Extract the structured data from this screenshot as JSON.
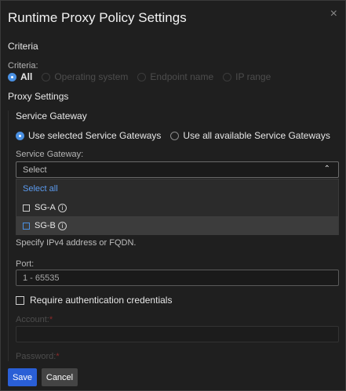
{
  "dialog": {
    "title": "Runtime Proxy Policy Settings",
    "close_icon": "×"
  },
  "criteria": {
    "section_title": "Criteria",
    "label": "Criteria:",
    "options": [
      {
        "label": "All",
        "selected": true,
        "disabled": false
      },
      {
        "label": "Operating system",
        "selected": false,
        "disabled": true
      },
      {
        "label": "Endpoint name",
        "selected": false,
        "disabled": true
      },
      {
        "label": "IP range",
        "selected": false,
        "disabled": true
      }
    ]
  },
  "proxy": {
    "section_title": "Proxy Settings",
    "service_gateway_title": "Service Gateway",
    "mode_options": [
      {
        "label": "Use selected Service Gateways",
        "selected": true
      },
      {
        "label": "Use all available Service Gateways",
        "selected": false
      }
    ],
    "gateway_label": "Service Gateway:",
    "select_placeholder": "Select",
    "dropdown": {
      "select_all": "Select all",
      "items": [
        {
          "label": "SG-A",
          "checked": false,
          "hovered": false
        },
        {
          "label": "SG-B",
          "checked": false,
          "hovered": true
        }
      ]
    },
    "address_hint": "Specify IPv4 address or FQDN.",
    "port_label": "Port:",
    "port_placeholder": "1 - 65535",
    "auth_label": "Require authentication credentials",
    "account_label": "Account:",
    "password_label": "Password:",
    "required_mark": "*"
  },
  "footer": {
    "save_label": "Save",
    "cancel_label": "Cancel"
  },
  "colors": {
    "accent": "#4a90e2",
    "primary_button": "#2a5fd6",
    "background": "#1f1f1f"
  }
}
